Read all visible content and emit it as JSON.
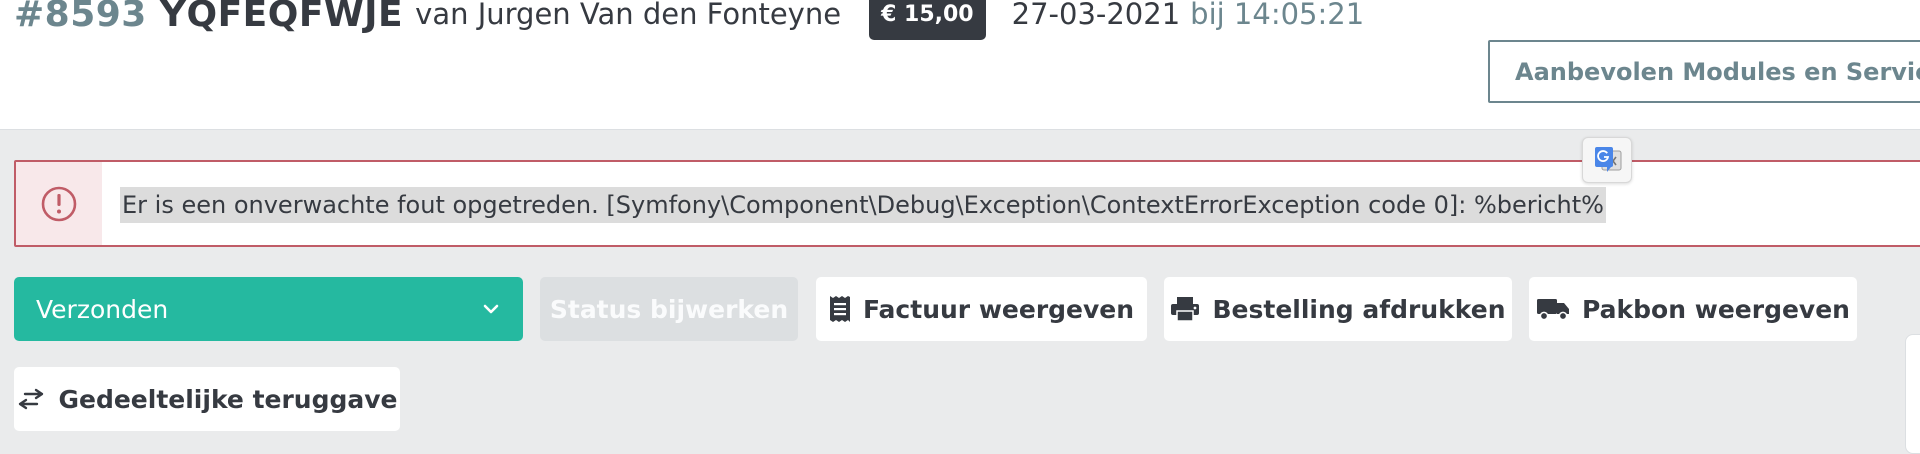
{
  "header": {
    "order_number": "#8593",
    "order_reference": "YQFEQFWJE",
    "by_customer": "van Jurgen Van den Fonteyne",
    "total_badge": "€ 15,00",
    "date": "27-03-2021",
    "time": "bij 14:05:21",
    "recommended_button": "Aanbevolen Modules en Services"
  },
  "alert": {
    "icon": "alert-circle-icon",
    "message": "Er is een onverwachte fout opgetreden. [Symfony\\Component\\Debug\\Exception\\ContextErrorException code 0]: %bericht%",
    "color": "#c05c67"
  },
  "actions": {
    "status_select_value": "Verzonden",
    "update_status_label": "Status bijwerken",
    "view_invoice_label": "Factuur weergeven",
    "print_order_label": "Bestelling afdrukken",
    "view_packing_slip_label": "Pakbon weergeven",
    "partial_refund_label": "Gedeeltelijke teruggave"
  },
  "colors": {
    "accent_green": "#25b9a0",
    "muted_blue": "#6c868e",
    "dark_text": "#363a41"
  }
}
